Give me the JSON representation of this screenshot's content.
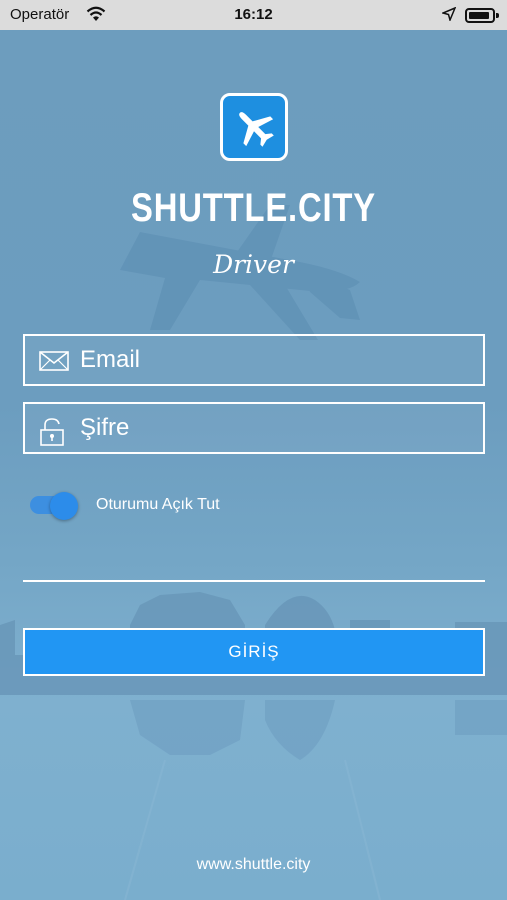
{
  "status_bar": {
    "carrier": "Operatör",
    "time": "16:12",
    "icons": [
      "wifi-icon",
      "location-arrow-icon",
      "battery-icon"
    ]
  },
  "app": {
    "brand": "SHUTTLE.CITY",
    "subtitle": "Driver",
    "logo_icon": "airplane-icon"
  },
  "form": {
    "email": {
      "placeholder": "Email",
      "value": "",
      "icon": "envelope-icon"
    },
    "password": {
      "placeholder": "Şifre",
      "value": "",
      "icon": "lock-icon"
    },
    "remember": {
      "label": "Oturumu Açık Tut",
      "checked": true
    },
    "login_label": "GİRİŞ"
  },
  "footer": {
    "link": "www.shuttle.city"
  },
  "colors": {
    "background": "#6f9fc0",
    "accent": "#2196f3",
    "logo_bg": "#1e8fe0",
    "text": "#ffffff"
  }
}
